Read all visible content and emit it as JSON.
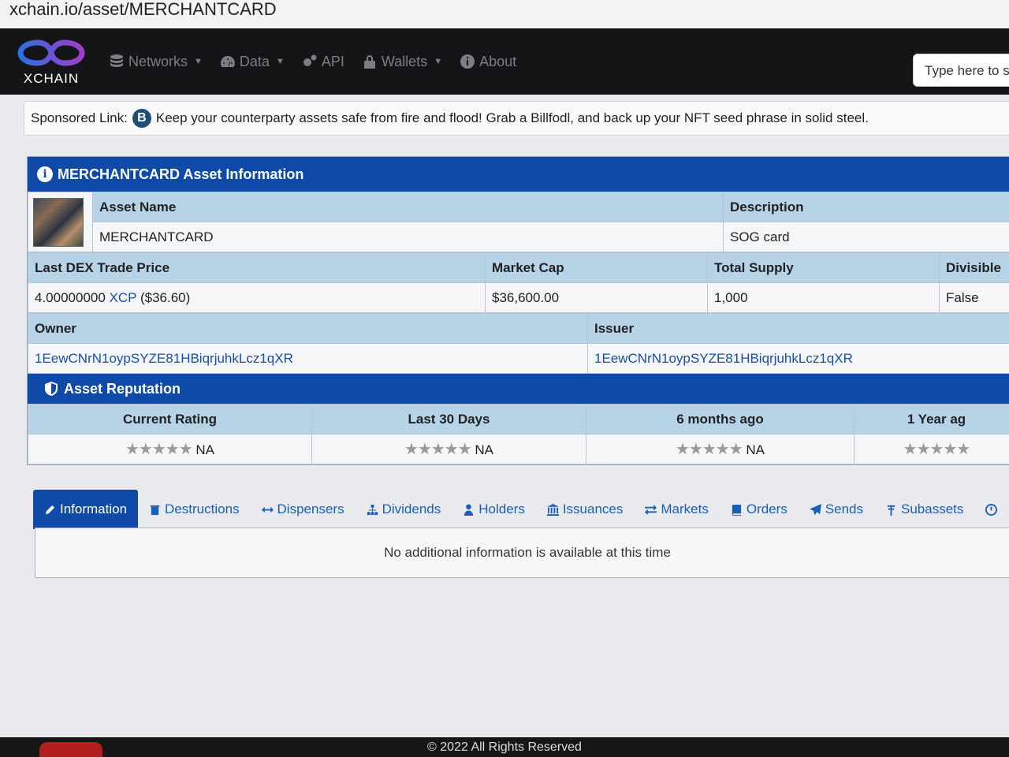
{
  "url": "xchain.io/asset/MERCHANTCARD",
  "nav": {
    "brand": "XCHAIN",
    "items": [
      {
        "label": "Networks",
        "icon": "database-icon",
        "dropdown": true
      },
      {
        "label": "Data",
        "icon": "dashboard-icon",
        "dropdown": true
      },
      {
        "label": "API",
        "icon": "gears-icon",
        "dropdown": false
      },
      {
        "label": "Wallets",
        "icon": "lock-icon",
        "dropdown": true
      },
      {
        "label": "About",
        "icon": "info-icon",
        "dropdown": false
      }
    ],
    "search_placeholder": "Type here to se"
  },
  "sponsor": {
    "label": "Sponsored Link:",
    "text": "Keep your counterparty assets safe from fire and flood! Grab a Billfodl, and back up your NFT seed phrase in solid steel."
  },
  "asset_info": {
    "title": "MERCHANTCARD Asset Information",
    "asset_name_label": "Asset Name",
    "asset_name": "MERCHANTCARD",
    "description_label": "Description",
    "description": "SOG card",
    "last_price_label": "Last DEX Trade Price",
    "last_price_value": "4.00000000",
    "last_price_unit": "XCP",
    "last_price_usd": "($36.60)",
    "market_cap_label": "Market Cap",
    "market_cap": "$36,600.00",
    "total_supply_label": "Total Supply",
    "total_supply": "1,000",
    "divisible_label": "Divisible",
    "divisible": "False",
    "owner_label": "Owner",
    "owner": "1EewCNrN1oypSYZE81HBiqrjuhkLcz1qXR",
    "issuer_label": "Issuer",
    "issuer": "1EewCNrN1oypSYZE81HBiqrjuhkLcz1qXR"
  },
  "reputation": {
    "title": "Asset Reputation",
    "columns": [
      "Current Rating",
      "Last 30 Days",
      "6 months ago",
      "1 Year ag"
    ],
    "values": [
      "NA",
      "NA",
      "NA",
      ""
    ],
    "stars": "★★★★★"
  },
  "tabs": [
    {
      "label": "Information",
      "active": true
    },
    {
      "label": "Destructions"
    },
    {
      "label": "Dispensers"
    },
    {
      "label": "Dividends"
    },
    {
      "label": "Holders"
    },
    {
      "label": "Issuances"
    },
    {
      "label": "Markets"
    },
    {
      "label": "Orders"
    },
    {
      "label": "Sends"
    },
    {
      "label": "Subassets"
    }
  ],
  "tab_body": "No additional information is available at this time",
  "footer": "© 2022 All Rights Reserved"
}
